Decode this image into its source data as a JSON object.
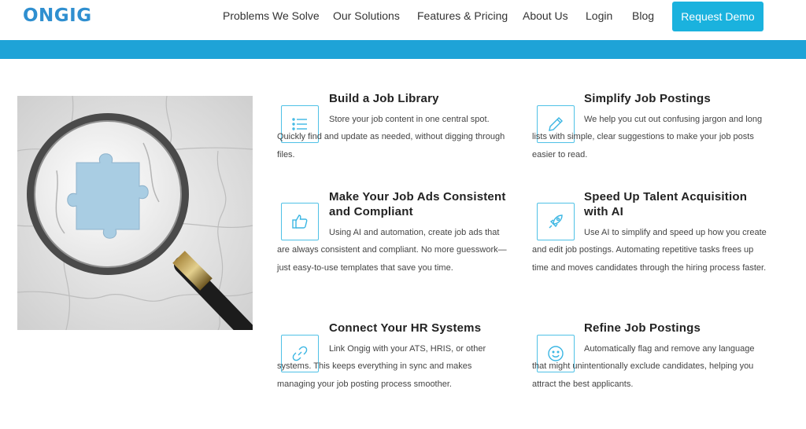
{
  "header": {
    "logo": "ONGIG",
    "nav": [
      "Problems We Solve",
      "Our Solutions",
      "Features & Pricing",
      "About Us",
      "Login",
      "Blog"
    ],
    "cta": "Request Demo"
  },
  "colors": {
    "brand": "#2f8fd0",
    "accent": "#1ab2de",
    "band": "#1ea3d7",
    "icon_border": "#4fc1e6"
  },
  "features": [
    {
      "title": "Build a Job Library",
      "text": "Store your job content in one central spot. Quickly find and update as needed, without digging through files.",
      "icon": "list-icon"
    },
    {
      "title": "Simplify Job Postings",
      "text": "We help you cut out confusing jargon and long lists with simple, clear suggestions to make your job posts easier to read.",
      "icon": "pencil-icon"
    },
    {
      "title": "Make Your Job Ads Consistent and Compliant",
      "text": "Using AI and automation, create job ads that are always consistent and compliant. No more guesswork—just easy-to-use templates that save you time.",
      "icon": "thumbs-up-icon"
    },
    {
      "title": "Speed Up Talent Acquisition with AI",
      "text": "Use AI to simplify and speed up how you create and edit job postings. Automating repetitive tasks frees up time and moves candidates through the hiring process faster.",
      "icon": "rocket-icon"
    },
    {
      "title": "Connect Your HR Systems",
      "text": "Link Ongig with your ATS, HRIS, or other systems. This keeps everything in sync and makes managing your job posting process smoother.",
      "icon": "link-icon"
    },
    {
      "title": "Refine Job Postings",
      "text": "Automatically flag and remove any language that might unintentionally exclude candidates, helping you attract the best applicants.",
      "icon": "smiley-icon"
    }
  ]
}
